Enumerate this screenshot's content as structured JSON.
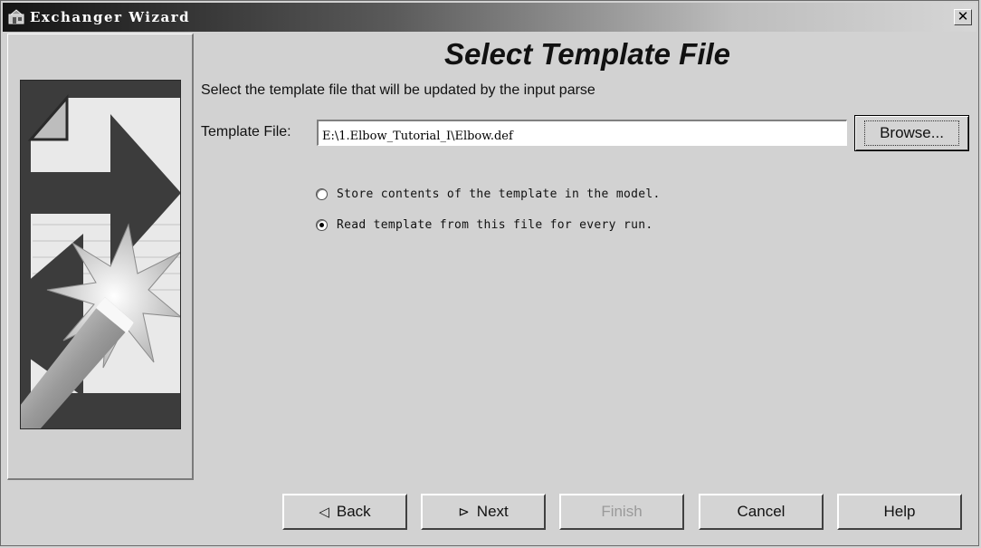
{
  "window": {
    "title": "Exchanger Wizard",
    "close_glyph": "✕"
  },
  "page": {
    "title": "Select Template File",
    "instructions": "Select the template file that will be updated by the input parse"
  },
  "template_file": {
    "label": "Template File:",
    "value": "E:\\1.Elbow_Tutorial_I\\Elbow.def",
    "browse_label": "Browse..."
  },
  "options": [
    {
      "label": "Store contents of the template in the model.",
      "checked": false
    },
    {
      "label": "Read template from this file for every run.",
      "checked": true
    }
  ],
  "buttons": {
    "back": {
      "label": "Back",
      "icon": "back-triangle-icon",
      "glyph": "◁"
    },
    "next": {
      "label": "Next",
      "icon": "next-flag-icon",
      "glyph": "⊳"
    },
    "finish": {
      "label": "Finish",
      "enabled": false
    },
    "cancel": {
      "label": "Cancel"
    },
    "help": {
      "label": "Help"
    }
  },
  "colors": {
    "window_bg": "#d2d2d2",
    "title_gradient_start": "#141414",
    "disabled_text": "#9a9a9a"
  }
}
